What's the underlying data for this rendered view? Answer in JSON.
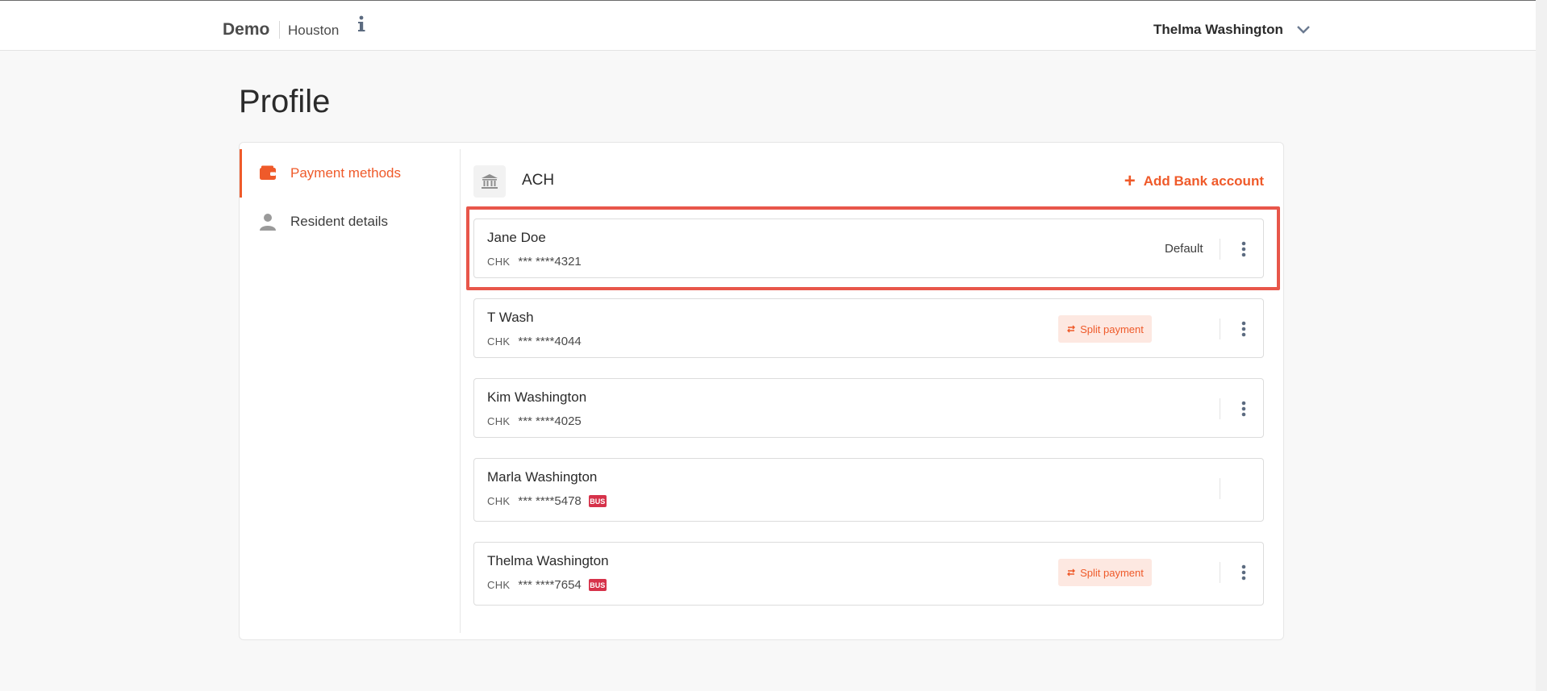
{
  "header": {
    "brand": "Demo",
    "location": "Houston",
    "user_name": "Thelma Washington"
  },
  "page": {
    "title": "Profile"
  },
  "sidebar": {
    "items": [
      {
        "label": "Payment methods",
        "icon": "wallet-icon",
        "active": true
      },
      {
        "label": "Resident details",
        "icon": "person-icon",
        "active": false
      }
    ]
  },
  "ach": {
    "label": "ACH",
    "add_label": "Add Bank account",
    "accounts": [
      {
        "name": "Jane Doe",
        "type": "CHK",
        "mask": "*** ****4321",
        "default_label": "Default"
      },
      {
        "name": "T Wash",
        "type": "CHK",
        "mask": "*** ****4044",
        "split_label": "Split payment"
      },
      {
        "name": "Kim Washington",
        "type": "CHK",
        "mask": "*** ****4025"
      },
      {
        "name": "Marla Washington",
        "type": "CHK",
        "mask": "*** ****5478",
        "badge": "BUS"
      },
      {
        "name": "Thelma Washington",
        "type": "CHK",
        "mask": "*** ****7654",
        "badge": "BUS",
        "split_label": "Split payment"
      }
    ]
  },
  "colors": {
    "accent": "#ef5a2a",
    "highlight": "#e8564a",
    "bus_badge": "#d6324a"
  }
}
